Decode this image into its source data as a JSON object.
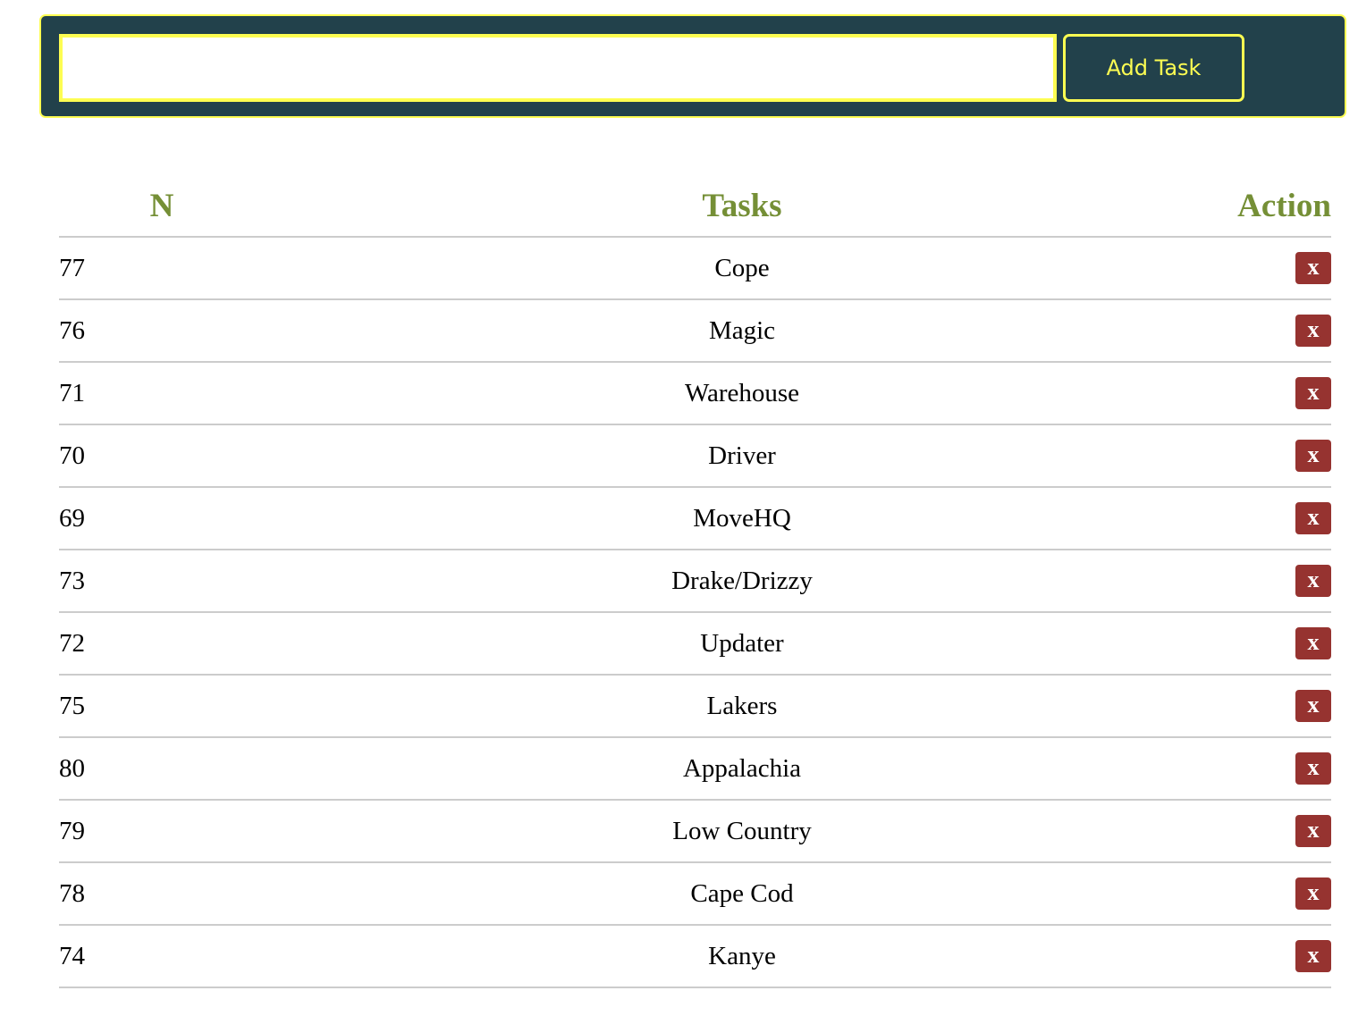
{
  "form": {
    "input_value": "",
    "input_placeholder": "",
    "add_button_label": "Add Task"
  },
  "table": {
    "headers": {
      "n": "N",
      "task": "Tasks",
      "action": "Action"
    },
    "rows": [
      {
        "n": "77",
        "task": "Cope",
        "action": "x"
      },
      {
        "n": "76",
        "task": "Magic",
        "action": "x"
      },
      {
        "n": "71",
        "task": "Warehouse",
        "action": "x"
      },
      {
        "n": "70",
        "task": "Driver",
        "action": "x"
      },
      {
        "n": "69",
        "task": "MoveHQ",
        "action": "x"
      },
      {
        "n": "73",
        "task": "Drake/Drizzy",
        "action": "x"
      },
      {
        "n": "72",
        "task": "Updater",
        "action": "x"
      },
      {
        "n": "75",
        "task": "Lakers",
        "action": "x"
      },
      {
        "n": "80",
        "task": "Appalachia",
        "action": "x"
      },
      {
        "n": "79",
        "task": "Low Country",
        "action": "x"
      },
      {
        "n": "78",
        "task": "Cape Cod",
        "action": "x"
      },
      {
        "n": "74",
        "task": "Kanye",
        "action": "x"
      }
    ]
  },
  "colors": {
    "form_background": "#22414b",
    "accent_yellow": "#fdfd52",
    "header_green": "#758f36",
    "delete_red": "#963330",
    "row_divider": "#cccccc"
  }
}
